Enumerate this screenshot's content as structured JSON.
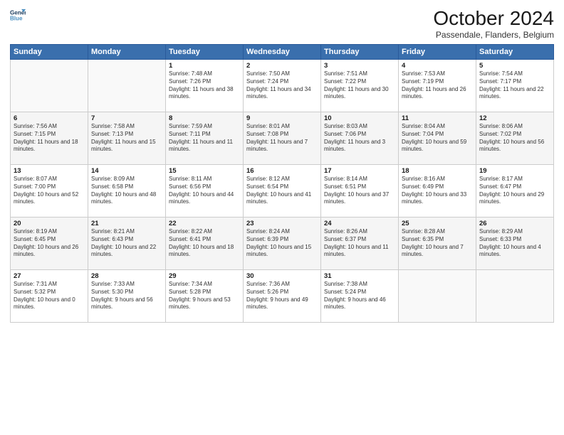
{
  "header": {
    "title": "October 2024",
    "location": "Passendale, Flanders, Belgium"
  },
  "columns": [
    "Sunday",
    "Monday",
    "Tuesday",
    "Wednesday",
    "Thursday",
    "Friday",
    "Saturday"
  ],
  "weeks": [
    [
      {
        "day": "",
        "info": ""
      },
      {
        "day": "",
        "info": ""
      },
      {
        "day": "1",
        "info": "Sunrise: 7:48 AM\nSunset: 7:26 PM\nDaylight: 11 hours and 38 minutes."
      },
      {
        "day": "2",
        "info": "Sunrise: 7:50 AM\nSunset: 7:24 PM\nDaylight: 11 hours and 34 minutes."
      },
      {
        "day": "3",
        "info": "Sunrise: 7:51 AM\nSunset: 7:22 PM\nDaylight: 11 hours and 30 minutes."
      },
      {
        "day": "4",
        "info": "Sunrise: 7:53 AM\nSunset: 7:19 PM\nDaylight: 11 hours and 26 minutes."
      },
      {
        "day": "5",
        "info": "Sunrise: 7:54 AM\nSunset: 7:17 PM\nDaylight: 11 hours and 22 minutes."
      }
    ],
    [
      {
        "day": "6",
        "info": "Sunrise: 7:56 AM\nSunset: 7:15 PM\nDaylight: 11 hours and 18 minutes."
      },
      {
        "day": "7",
        "info": "Sunrise: 7:58 AM\nSunset: 7:13 PM\nDaylight: 11 hours and 15 minutes."
      },
      {
        "day": "8",
        "info": "Sunrise: 7:59 AM\nSunset: 7:11 PM\nDaylight: 11 hours and 11 minutes."
      },
      {
        "day": "9",
        "info": "Sunrise: 8:01 AM\nSunset: 7:08 PM\nDaylight: 11 hours and 7 minutes."
      },
      {
        "day": "10",
        "info": "Sunrise: 8:03 AM\nSunset: 7:06 PM\nDaylight: 11 hours and 3 minutes."
      },
      {
        "day": "11",
        "info": "Sunrise: 8:04 AM\nSunset: 7:04 PM\nDaylight: 10 hours and 59 minutes."
      },
      {
        "day": "12",
        "info": "Sunrise: 8:06 AM\nSunset: 7:02 PM\nDaylight: 10 hours and 56 minutes."
      }
    ],
    [
      {
        "day": "13",
        "info": "Sunrise: 8:07 AM\nSunset: 7:00 PM\nDaylight: 10 hours and 52 minutes."
      },
      {
        "day": "14",
        "info": "Sunrise: 8:09 AM\nSunset: 6:58 PM\nDaylight: 10 hours and 48 minutes."
      },
      {
        "day": "15",
        "info": "Sunrise: 8:11 AM\nSunset: 6:56 PM\nDaylight: 10 hours and 44 minutes."
      },
      {
        "day": "16",
        "info": "Sunrise: 8:12 AM\nSunset: 6:54 PM\nDaylight: 10 hours and 41 minutes."
      },
      {
        "day": "17",
        "info": "Sunrise: 8:14 AM\nSunset: 6:51 PM\nDaylight: 10 hours and 37 minutes."
      },
      {
        "day": "18",
        "info": "Sunrise: 8:16 AM\nSunset: 6:49 PM\nDaylight: 10 hours and 33 minutes."
      },
      {
        "day": "19",
        "info": "Sunrise: 8:17 AM\nSunset: 6:47 PM\nDaylight: 10 hours and 29 minutes."
      }
    ],
    [
      {
        "day": "20",
        "info": "Sunrise: 8:19 AM\nSunset: 6:45 PM\nDaylight: 10 hours and 26 minutes."
      },
      {
        "day": "21",
        "info": "Sunrise: 8:21 AM\nSunset: 6:43 PM\nDaylight: 10 hours and 22 minutes."
      },
      {
        "day": "22",
        "info": "Sunrise: 8:22 AM\nSunset: 6:41 PM\nDaylight: 10 hours and 18 minutes."
      },
      {
        "day": "23",
        "info": "Sunrise: 8:24 AM\nSunset: 6:39 PM\nDaylight: 10 hours and 15 minutes."
      },
      {
        "day": "24",
        "info": "Sunrise: 8:26 AM\nSunset: 6:37 PM\nDaylight: 10 hours and 11 minutes."
      },
      {
        "day": "25",
        "info": "Sunrise: 8:28 AM\nSunset: 6:35 PM\nDaylight: 10 hours and 7 minutes."
      },
      {
        "day": "26",
        "info": "Sunrise: 8:29 AM\nSunset: 6:33 PM\nDaylight: 10 hours and 4 minutes."
      }
    ],
    [
      {
        "day": "27",
        "info": "Sunrise: 7:31 AM\nSunset: 5:32 PM\nDaylight: 10 hours and 0 minutes."
      },
      {
        "day": "28",
        "info": "Sunrise: 7:33 AM\nSunset: 5:30 PM\nDaylight: 9 hours and 56 minutes."
      },
      {
        "day": "29",
        "info": "Sunrise: 7:34 AM\nSunset: 5:28 PM\nDaylight: 9 hours and 53 minutes."
      },
      {
        "day": "30",
        "info": "Sunrise: 7:36 AM\nSunset: 5:26 PM\nDaylight: 9 hours and 49 minutes."
      },
      {
        "day": "31",
        "info": "Sunrise: 7:38 AM\nSunset: 5:24 PM\nDaylight: 9 hours and 46 minutes."
      },
      {
        "day": "",
        "info": ""
      },
      {
        "day": "",
        "info": ""
      }
    ]
  ]
}
